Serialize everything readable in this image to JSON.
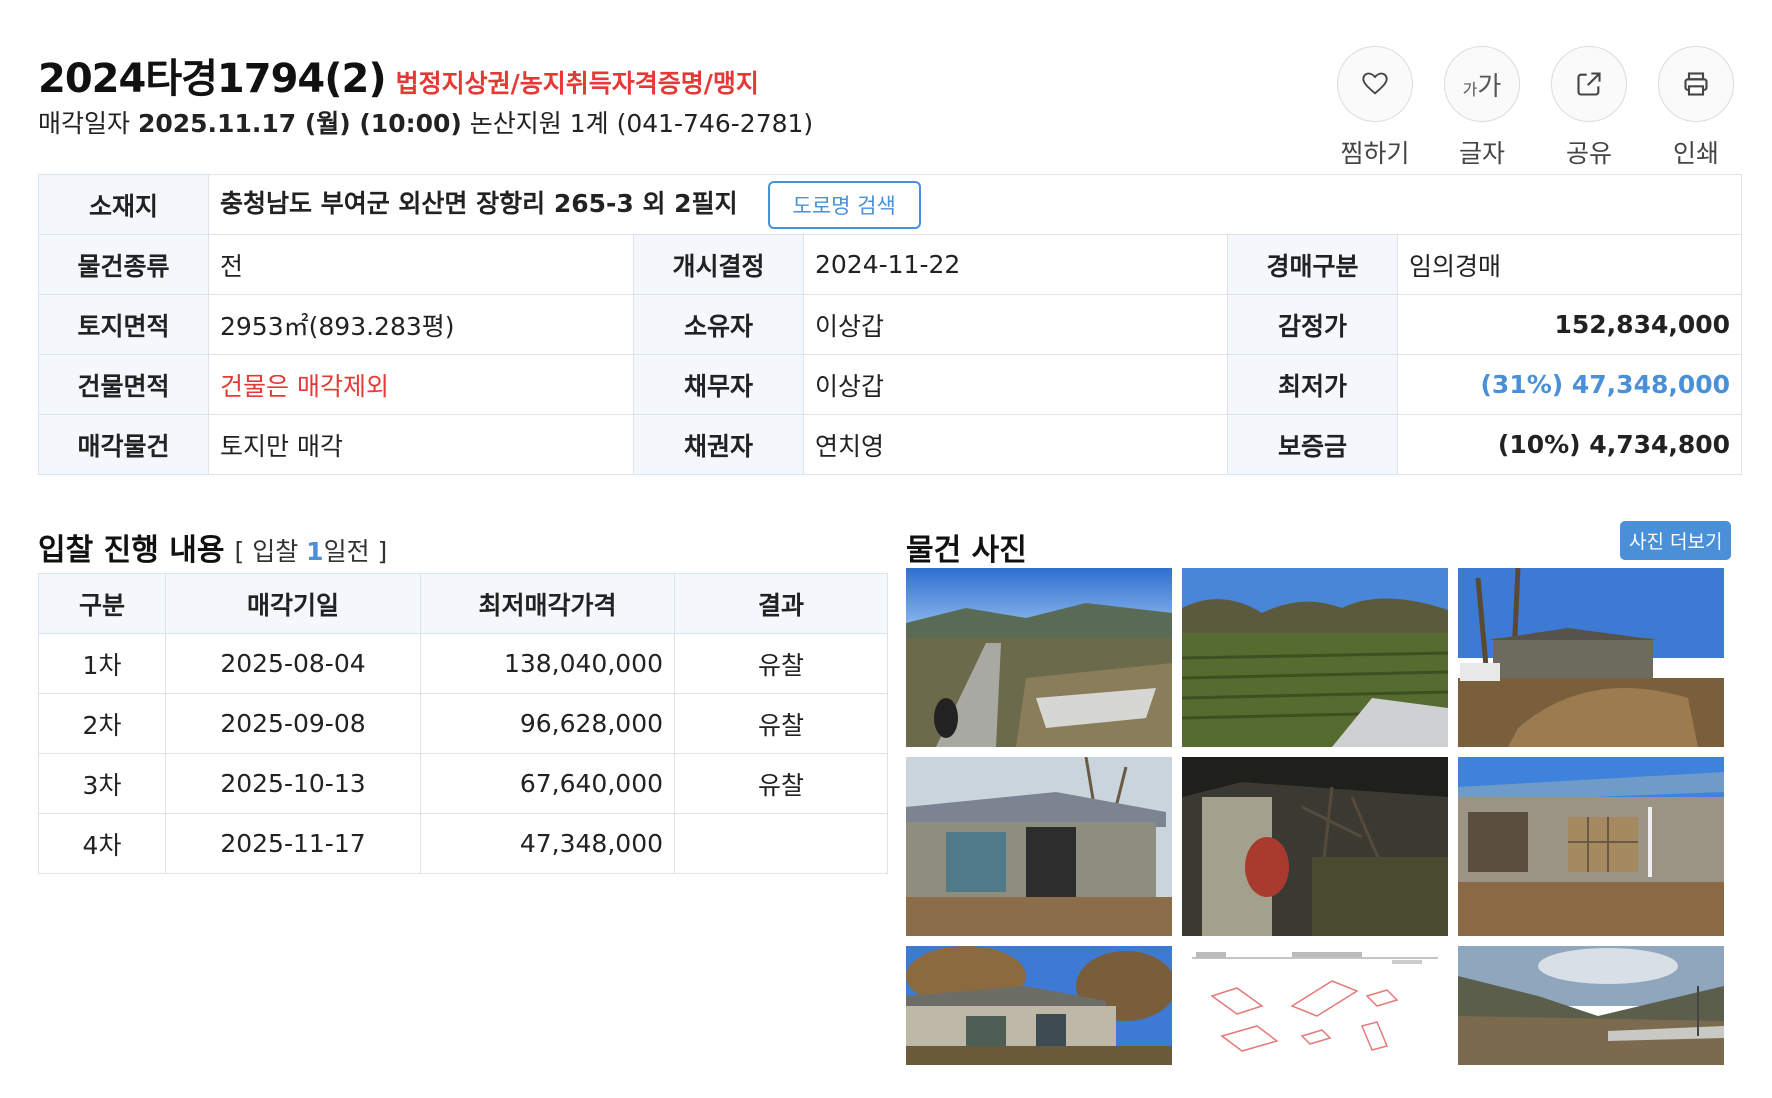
{
  "header": {
    "case_number": "2024타경1794(2)",
    "tags": "법정지상권/농지취득자격증명/맹지",
    "sale_label": "매각일자",
    "sale_datetime": "2025.11.17 (월) (10:00)",
    "court": "논산지원 1계 (041-746-2781)"
  },
  "actions": [
    {
      "label": "찜하기",
      "icon": "heart-icon"
    },
    {
      "label": "글자",
      "icon": "font-size-icon",
      "glyph_small": "가",
      "glyph_large": "가"
    },
    {
      "label": "공유",
      "icon": "share-icon"
    },
    {
      "label": "인쇄",
      "icon": "print-icon"
    }
  ],
  "info": {
    "location_label": "소재지",
    "location_value": "충청남도 부여군 외산면 장항리 265-3 외 2필지",
    "road_search_label": "도로명 검색",
    "rows": [
      {
        "c1": "물건종류",
        "v1": "전",
        "c2": "개시결정",
        "v2": "2024-11-22",
        "c3": "경매구분",
        "v3": "임의경매"
      },
      {
        "c1": "토지면적",
        "v1": "2953㎡(893.283평)",
        "c2": "소유자",
        "v2": "이상갑",
        "c3": "감정가",
        "v3": "152,834,000"
      },
      {
        "c1": "건물면적",
        "v1": "건물은 매각제외",
        "c2": "채무자",
        "v2": "이상갑",
        "c3": "최저가",
        "v3": "(31%) 47,348,000"
      },
      {
        "c1": "매각물건",
        "v1": "토지만 매각",
        "c2": "채권자",
        "v2": "연치영",
        "c3": "보증금",
        "v3": "(10%) 4,734,800"
      }
    ]
  },
  "bids": {
    "title": "입찰 진행 내용",
    "sub_prefix": "[ 입찰 ",
    "sub_num": "1",
    "sub_suffix": "일전 ]",
    "headers": [
      "구분",
      "매각기일",
      "최저매각가격",
      "결과"
    ],
    "rows": [
      {
        "round": "1차",
        "date": "2025-08-04",
        "price": "138,040,000",
        "result": "유찰"
      },
      {
        "round": "2차",
        "date": "2025-09-08",
        "price": "96,628,000",
        "result": "유찰"
      },
      {
        "round": "3차",
        "date": "2025-10-13",
        "price": "67,640,000",
        "result": "유찰"
      },
      {
        "round": "4차",
        "date": "2025-11-17",
        "price": "47,348,000",
        "result": ""
      }
    ]
  },
  "photos": {
    "title": "물건 사진",
    "more_label": "사진 더보기",
    "items": [
      "field-road-photo",
      "field-crops-photo",
      "house-debris-photo",
      "house-shed-photo",
      "house-wall-photo",
      "house-front-photo",
      "house-trees-photo",
      "land-map-drawing",
      "valley-photo"
    ]
  },
  "colors": {
    "accent_red": "#e53935",
    "accent_blue": "#4a90d9",
    "header_cell_bg": "#f4f7fb",
    "border": "#dde3ea"
  }
}
